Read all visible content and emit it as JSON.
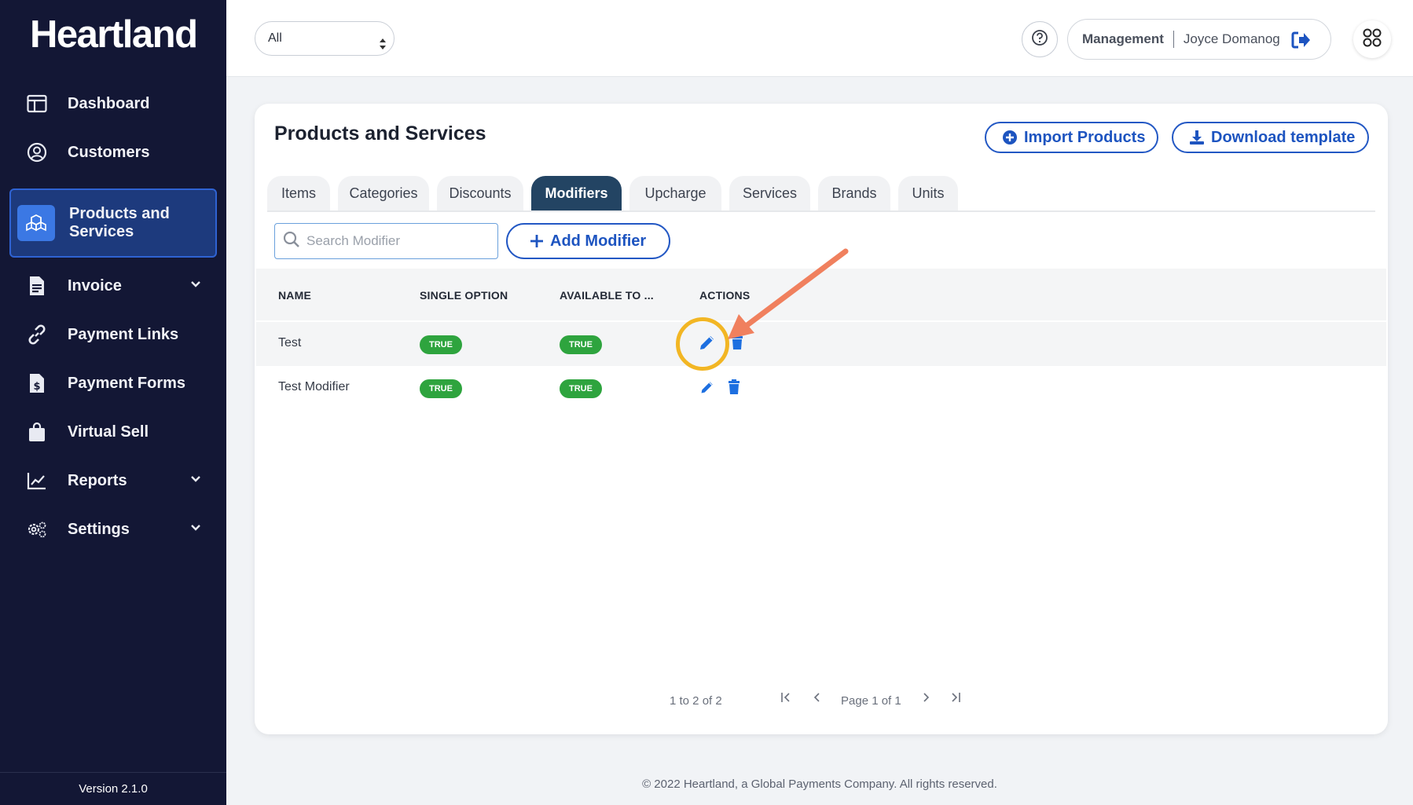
{
  "brand": {
    "logo": "Heartland"
  },
  "sidebar": {
    "items": [
      {
        "label": "Dashboard",
        "icon": "dashboard-icon"
      },
      {
        "label": "Customers",
        "icon": "customers-icon"
      },
      {
        "label": "Products and Services",
        "icon": "products-icon",
        "active": true
      },
      {
        "label": "Invoice",
        "icon": "invoice-icon",
        "expandable": true
      },
      {
        "label": "Payment Links",
        "icon": "link-icon"
      },
      {
        "label": "Payment Forms",
        "icon": "payment-forms-icon"
      },
      {
        "label": "Virtual Sell",
        "icon": "shopping-bag-icon"
      },
      {
        "label": "Reports",
        "icon": "reports-icon",
        "expandable": true
      },
      {
        "label": "Settings",
        "icon": "settings-icon",
        "expandable": true
      }
    ],
    "version": "Version 2.1.0"
  },
  "topbar": {
    "filter": {
      "selected": "All"
    },
    "user": {
      "role": "Management",
      "name": "Joyce Domanog"
    }
  },
  "page": {
    "title": "Products and Services",
    "import_label": "Import Products",
    "download_label": "Download template",
    "tabs": [
      "Items",
      "Categories",
      "Discounts",
      "Modifiers",
      "Upcharge",
      "Services",
      "Brands",
      "Units"
    ],
    "active_tab": "Modifiers",
    "search_placeholder": "Search Modifier",
    "add_label": "Add Modifier"
  },
  "table": {
    "columns": [
      "NAME",
      "SINGLE OPTION",
      "AVAILABLE TO ...",
      "ACTIONS"
    ],
    "rows": [
      {
        "name": "Test",
        "single_option": "TRUE",
        "available": "TRUE"
      },
      {
        "name": "Test Modifier",
        "single_option": "TRUE",
        "available": "TRUE"
      }
    ]
  },
  "pagination": {
    "summary": "1 to 2 of 2",
    "page_label": "Page 1 of 1"
  },
  "footer": "© 2022 Heartland, a Global Payments Company. All rights reserved.",
  "colors": {
    "sidebar_bg": "#131735",
    "accent": "#1d54c0",
    "active_tab": "#234463",
    "badge_green": "#2ea43e",
    "annotation_ring": "#f2b624",
    "annotation_arrow": "#f0805e"
  }
}
